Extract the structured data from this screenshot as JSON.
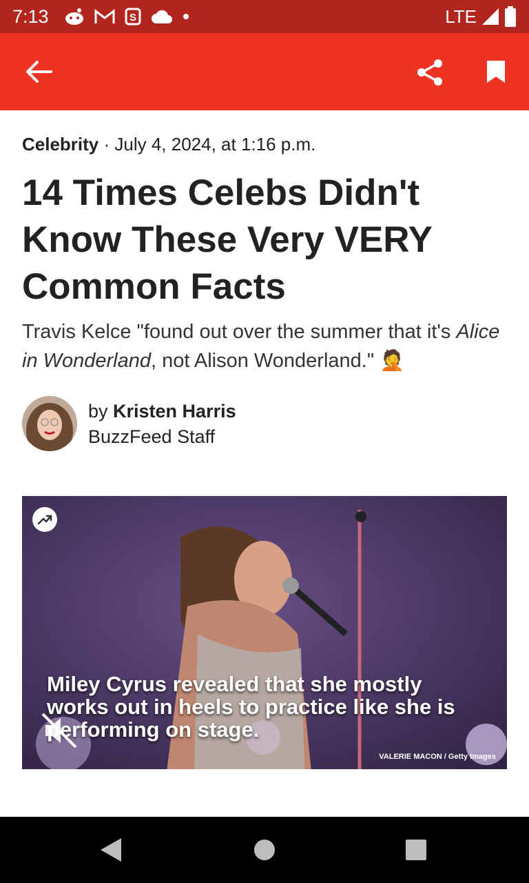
{
  "status_bar": {
    "time": "7:13",
    "network": "LTE"
  },
  "article": {
    "category": "Celebrity",
    "date": "· July 4, 2024, at 1:16 p.m.",
    "headline": "14 Times Celebs Didn't Know These Very VERY Common Facts",
    "dek_before": "Travis Kelce \"found out over the summer that it's ",
    "dek_italic": "Alice in Wonderland",
    "dek_after": ", not Alison Wonderland.\" 🤦",
    "byline_prefix": "by ",
    "author": "Kristen Harris",
    "author_role": "BuzzFeed Staff"
  },
  "video": {
    "caption": "Miley Cyrus revealed that she mostly works out in heels to practice like she is performing on stage.",
    "credit": "VALERIE MACON / Getty Images"
  },
  "colors": {
    "app_bar": "#ee3322",
    "status_bar": "#b3261e"
  }
}
